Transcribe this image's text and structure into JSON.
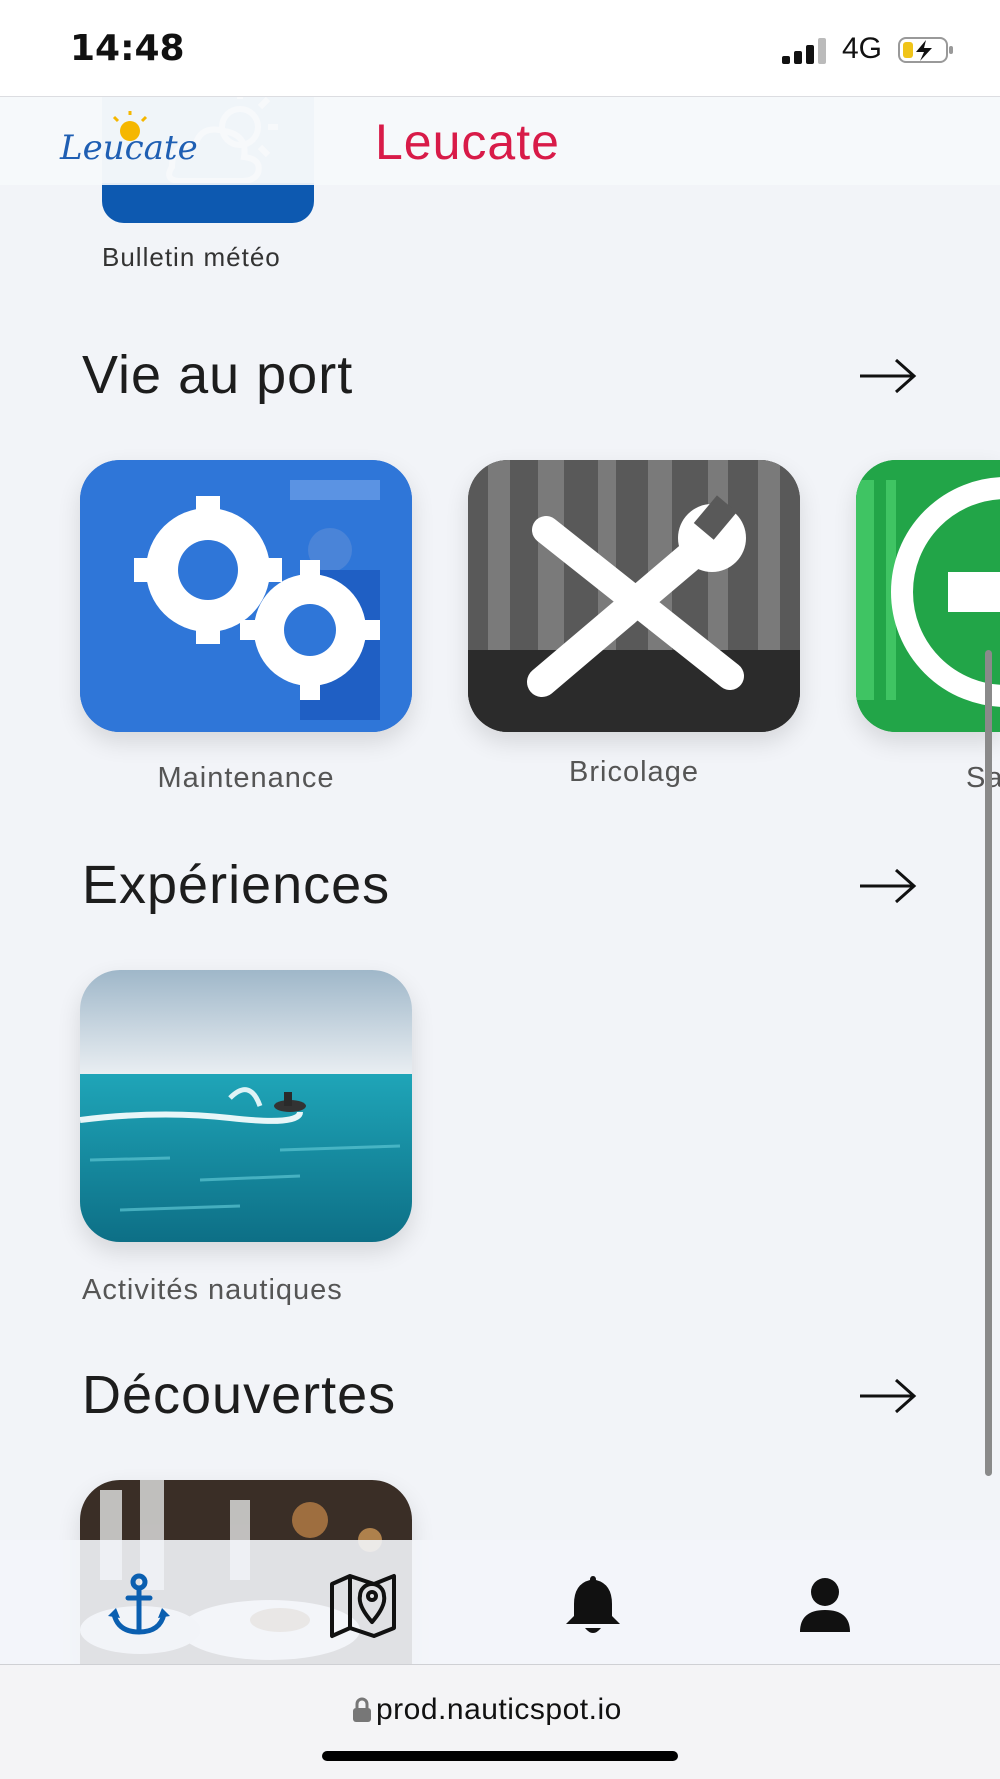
{
  "status_bar": {
    "time": "14:48",
    "network": "4G"
  },
  "header": {
    "title": "Leucate",
    "logo_text": "Leucate"
  },
  "weather": {
    "caption": "Bulletin météo"
  },
  "sections": {
    "vie_au_port": {
      "title": "Vie au port",
      "items": [
        {
          "label": "Maintenance"
        },
        {
          "label": "Bricolage"
        },
        {
          "label": "Sa"
        }
      ]
    },
    "experiences": {
      "title": "Expériences",
      "items": [
        {
          "label": "Activités nautiques"
        }
      ]
    },
    "decouvertes": {
      "title": "Découvertes"
    }
  },
  "bottom_nav": {
    "items": [
      {
        "icon": "anchor-icon",
        "active": true
      },
      {
        "icon": "map-pin-icon"
      },
      {
        "icon": "bell-icon"
      },
      {
        "icon": "user-icon"
      }
    ]
  },
  "browser": {
    "url": "prod.nauticspot.io"
  },
  "colors": {
    "brand_red": "#d81b48",
    "brand_blue": "#0d59b0",
    "nav_active": "#0b5fb0"
  }
}
